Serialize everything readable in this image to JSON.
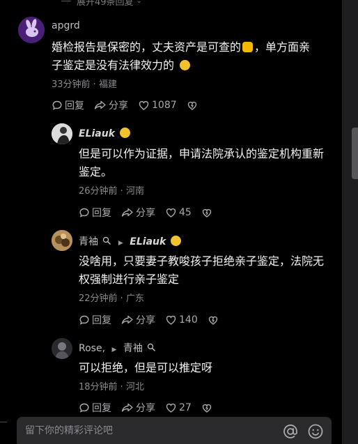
{
  "expand_replies": "展开49条回复",
  "comments": [
    {
      "user": "apgrd",
      "text_line1": "婚检报告是保密的，丈夫资产是可查的",
      "text_line1_tail": "，单方面亲",
      "text_line2": "子鉴定是没有法律效力的",
      "meta": "33分钟前 · 福建",
      "reply_label": "回复",
      "share_label": "分享",
      "likes": "1087"
    },
    {
      "user": "ELiauk",
      "text": "但是可以作为证据，申请法院承认的鉴定机构重新鉴定。",
      "meta": "26分钟前 · 河南",
      "reply_label": "回复",
      "share_label": "分享",
      "likes": "45"
    },
    {
      "user": "青袖",
      "reply_to": "ELiauk",
      "text": "没啥用，只要妻子教唆孩子拒绝亲子鉴定，法院无权强制进行亲子鉴定",
      "meta": "22分钟前 · 广东",
      "reply_label": "回复",
      "share_label": "分享",
      "likes": "140"
    },
    {
      "user": "Rose,",
      "reply_to": "青袖",
      "text": "可以拒绝，但是可以推定呀",
      "meta": "18分钟前 · 河北",
      "reply_label": "回复",
      "share_label": "分享",
      "likes": "27"
    }
  ],
  "input": {
    "placeholder": "留下你的精彩评论吧"
  },
  "icons": [
    "reply-icon",
    "share-icon",
    "heart-icon",
    "dislike-icon",
    "at-icon",
    "emoji-icon"
  ],
  "colors": {
    "background": "#000000",
    "input_bg": "#2a2a2d",
    "muted": "#8a8a8f"
  }
}
